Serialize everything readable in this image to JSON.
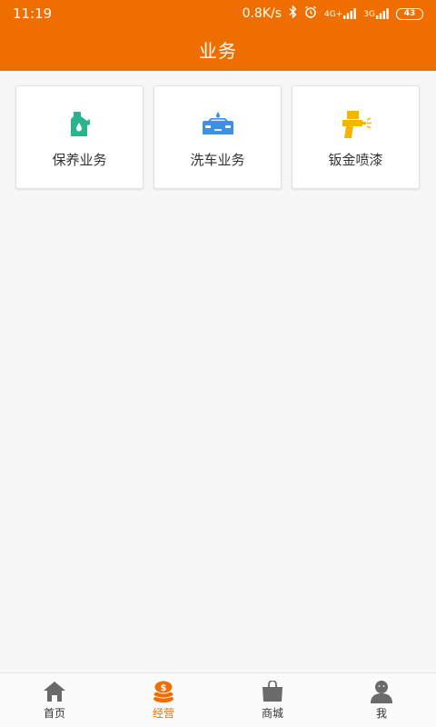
{
  "status_bar": {
    "time": "11:19",
    "speed": "0.8K/s",
    "net1": "4G+",
    "net2": "3G",
    "battery": "43"
  },
  "header": {
    "title": "业务"
  },
  "services": [
    {
      "label": "保养业务",
      "icon": "oil-bottle-icon"
    },
    {
      "label": "洗车业务",
      "icon": "car-wash-icon"
    },
    {
      "label": "钣金喷漆",
      "icon": "spray-gun-icon"
    }
  ],
  "tabs": [
    {
      "label": "首页",
      "icon": "home-icon"
    },
    {
      "label": "经营",
      "icon": "money-stack-icon",
      "active": true
    },
    {
      "label": "商城",
      "icon": "shopping-bag-icon"
    },
    {
      "label": "我",
      "icon": "user-icon"
    }
  ],
  "colors": {
    "primary": "#ee6f00",
    "oil_icon": "#2bb38f",
    "car_wash_icon": "#3f8fe6",
    "spray_icon": "#f5b400",
    "tab_icon": "#6a6a6a"
  }
}
